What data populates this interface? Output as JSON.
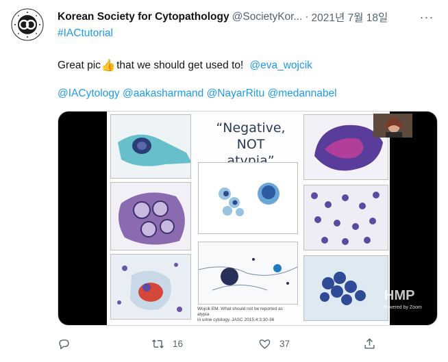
{
  "tweet": {
    "display_name": "Korean Society for Cytopathology",
    "handle": "@SocietyKor...",
    "separator": "·",
    "date": "2021년 7월 18일",
    "more_label": "···",
    "hashtag": "#IACtutorial",
    "text_before": "Great pic",
    "emoji": "👍",
    "text_after": "that we should get used to!",
    "text_mention": "@eva_wojcik",
    "mentions_line": "@IACytology @aakasharmand @NayarRitu @medannabel"
  },
  "avatar_logo_text": "THE KOREAN SOCIETY FOR CYTOPATHOLOGY 1986",
  "media": {
    "slide_title_line1": "“Negative,",
    "slide_title_line2": "NOT atypia”",
    "caption_line1": "Wojcik EM. What should not be reported as atypia",
    "caption_line2": "in urine cytology. JASC 2015;4:3;30-36",
    "watermark": "HMP",
    "powered_by": "Powered by Zoom"
  },
  "actions": {
    "reply_count": "",
    "retweet_count": "16",
    "like_count": "37",
    "share_count": ""
  },
  "colors": {
    "link": "#1d9bf0",
    "secondary_text": "#536471"
  }
}
